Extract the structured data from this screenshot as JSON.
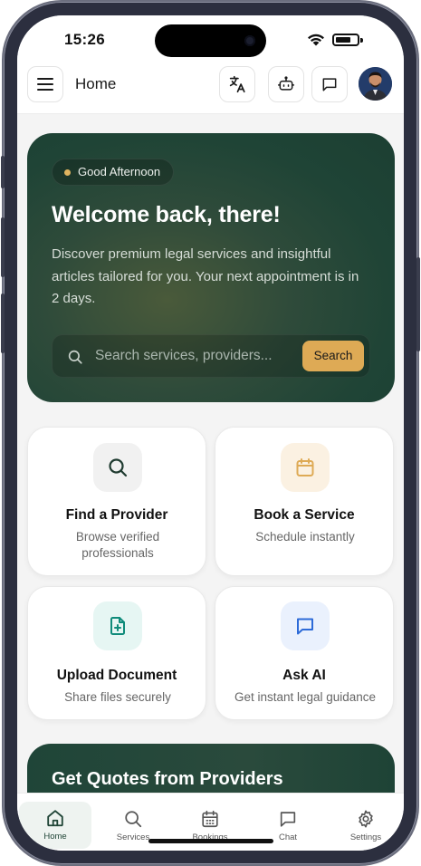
{
  "status_bar": {
    "time": "15:26"
  },
  "header": {
    "title": "Home",
    "menu_icon": "menu-icon",
    "actions": [
      "translate-icon",
      "robot-icon",
      "chat-bubble-icon"
    ],
    "avatar": "user-avatar"
  },
  "hero": {
    "greeting": "Good Afternoon",
    "title": "Welcome back, there!",
    "description": "Discover premium legal services and insightful articles tailored for you. Your next appointment is in 2 days.",
    "search_placeholder": "Search services, providers...",
    "search_button": "Search"
  },
  "actions": [
    {
      "title": "Find a Provider",
      "subtitle": "Browse verified professionals",
      "icon": "search-icon",
      "icon_bg": "#f1f1f1",
      "icon_color": "#1f3b30"
    },
    {
      "title": "Book a Service",
      "subtitle": "Schedule instantly",
      "icon": "calendar-icon",
      "icon_bg": "#fbf1e2",
      "icon_color": "#deaa55"
    },
    {
      "title": "Upload Document",
      "subtitle": "Share files securely",
      "icon": "file-plus-icon",
      "icon_bg": "#e6f6f3",
      "icon_color": "#0f8b7a"
    },
    {
      "title": "Ask AI",
      "subtitle": "Get instant legal guidance",
      "icon": "message-icon",
      "icon_bg": "#eaf1fd",
      "icon_color": "#2d6bd8"
    }
  ],
  "quotes_banner": {
    "title": "Get Quotes from Providers"
  },
  "bottom_nav": [
    {
      "label": "Home",
      "icon": "home-icon",
      "active": true
    },
    {
      "label": "Services",
      "icon": "search-icon",
      "active": false
    },
    {
      "label": "Bookings",
      "icon": "calendar-icon",
      "active": false
    },
    {
      "label": "Chat",
      "icon": "chat-icon",
      "active": false
    },
    {
      "label": "Settings",
      "icon": "gear-icon",
      "active": false
    }
  ],
  "colors": {
    "brand_dark_green": "#1f4436",
    "accent_gold": "#deaa55",
    "background": "#f4f4f4"
  }
}
